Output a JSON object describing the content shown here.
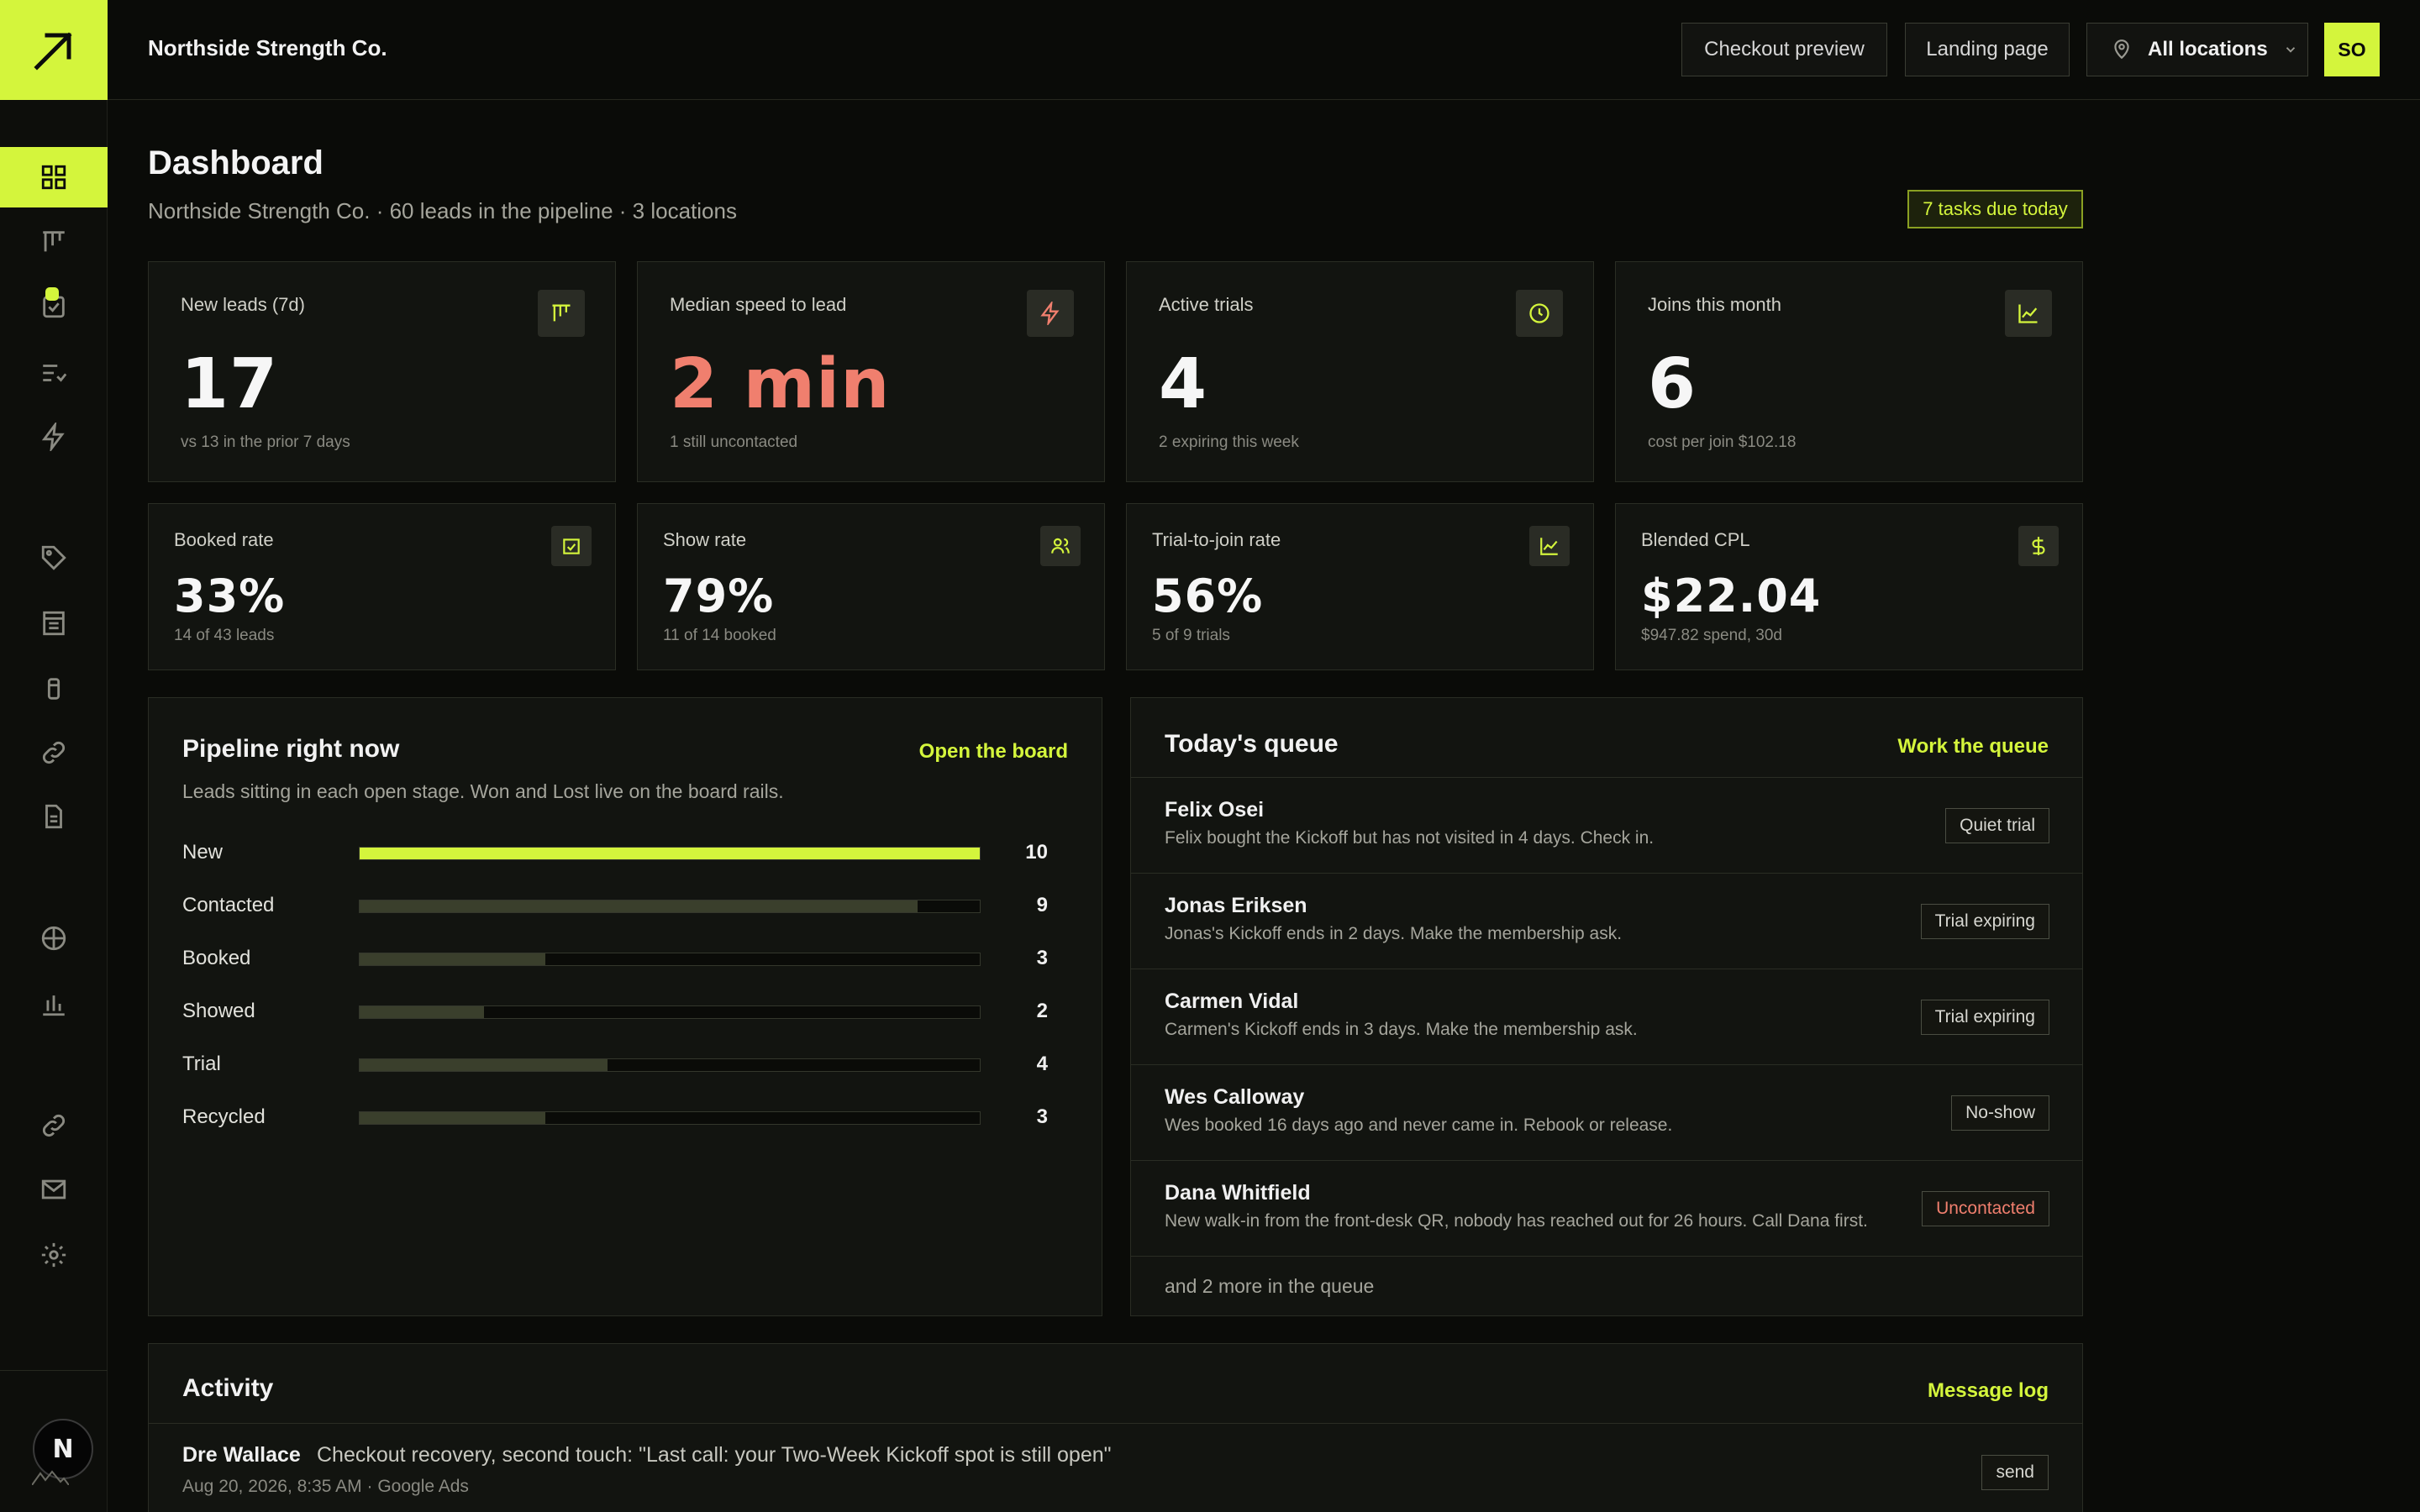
{
  "header": {
    "org_name": "Northside Strength Co.",
    "checkout_preview": "Checkout preview",
    "landing_page": "Landing page",
    "location_select": "All locations",
    "user_initials": "SO"
  },
  "sidebar": {
    "account_initial": "N",
    "items": [
      {
        "icon": "dashboard-grid-icon",
        "active": true
      },
      {
        "icon": "board-icon"
      },
      {
        "icon": "tasks-check-icon",
        "has_dot": true
      },
      {
        "icon": "queue-list-icon"
      },
      {
        "icon": "bolt-icon"
      },
      {
        "icon": "tag-icon"
      },
      {
        "icon": "forms-icon"
      },
      {
        "icon": "device-icon"
      },
      {
        "icon": "link-icon"
      },
      {
        "icon": "document-icon"
      },
      {
        "icon": "globe-icon"
      },
      {
        "icon": "bar-chart-icon"
      },
      {
        "icon": "integrations-link-icon"
      },
      {
        "icon": "mail-icon"
      },
      {
        "icon": "settings-gear-icon"
      }
    ]
  },
  "page": {
    "title": "Dashboard",
    "subtitle": "Northside Strength Co. · 60 leads in the pipeline · 3 locations",
    "tasks_badge": "7 tasks due today"
  },
  "stats_top": [
    {
      "label": "New leads (7d)",
      "value": "17",
      "note": "vs 13 in the prior 7 days",
      "icon": "board-icon"
    },
    {
      "label": "Median speed to lead",
      "value": "2 min",
      "note": "1 still uncontacted",
      "icon": "bolt-icon",
      "warn": true
    },
    {
      "label": "Active trials",
      "value": "4",
      "note": "2 expiring this week",
      "icon": "clock-icon"
    },
    {
      "label": "Joins this month",
      "value": "6",
      "note": "cost per join $102.18",
      "icon": "trend-chart-icon"
    }
  ],
  "stats_bottom": [
    {
      "label": "Booked rate",
      "value": "33%",
      "note": "14 of 43 leads",
      "icon": "calendar-check-icon"
    },
    {
      "label": "Show rate",
      "value": "79%",
      "note": "11 of 14 booked",
      "icon": "users-icon"
    },
    {
      "label": "Trial-to-join rate",
      "value": "56%",
      "note": "5 of 9 trials",
      "icon": "trend-chart-icon"
    },
    {
      "label": "Blended CPL",
      "value": "$22.04",
      "note": "$947.82 spend, 30d",
      "icon": "dollar-icon"
    }
  ],
  "pipeline": {
    "title": "Pipeline right now",
    "link": "Open the board",
    "description": "Leads sitting in each open stage. Won and Lost live on the board rails.",
    "max": 10,
    "stages": [
      {
        "label": "New",
        "count": 10
      },
      {
        "label": "Contacted",
        "count": 9
      },
      {
        "label": "Booked",
        "count": 3
      },
      {
        "label": "Showed",
        "count": 2
      },
      {
        "label": "Trial",
        "count": 4
      },
      {
        "label": "Recycled",
        "count": 3
      }
    ]
  },
  "queue": {
    "title": "Today's queue",
    "link": "Work the queue",
    "items": [
      {
        "name": "Felix Osei",
        "desc": "Felix bought the Kickoff but has not visited in 4 days. Check in.",
        "tag": "Quiet trial"
      },
      {
        "name": "Jonas Eriksen",
        "desc": "Jonas's Kickoff ends in 2 days. Make the membership ask.",
        "tag": "Trial expiring"
      },
      {
        "name": "Carmen Vidal",
        "desc": "Carmen's Kickoff ends in 3 days. Make the membership ask.",
        "tag": "Trial expiring"
      },
      {
        "name": "Wes Calloway",
        "desc": "Wes booked 16 days ago and never came in. Rebook or release.",
        "tag": "No-show"
      },
      {
        "name": "Dana Whitfield",
        "desc": "New walk-in from the front-desk QR, nobody has reached out for 26 hours. Call Dana first.",
        "tag": "Uncontacted",
        "alert": true
      }
    ],
    "more": "and 2 more in the queue"
  },
  "activity": {
    "title": "Activity",
    "link": "Message log",
    "items": [
      {
        "name": "Dre Wallace",
        "text": "Checkout recovery, second touch: \"Last call: your Two-Week Kickoff spot is still open\"",
        "meta": "Aug 20, 2026, 8:35 AM · Google Ads",
        "tag": "send"
      }
    ]
  },
  "colors": {
    "accent": "#d4f53c",
    "warn": "#f07f6e",
    "background": "#0a0b08",
    "card": "#121410"
  }
}
